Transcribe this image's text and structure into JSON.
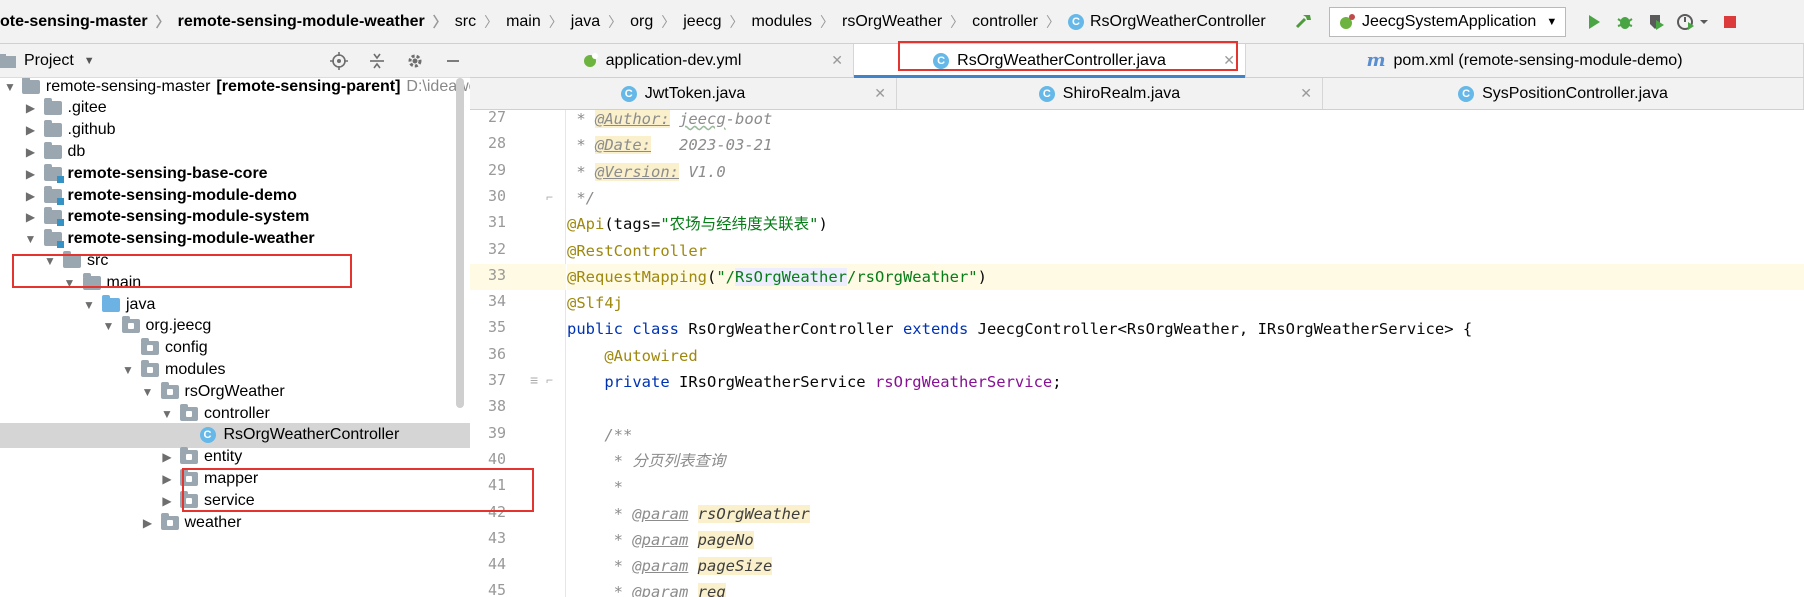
{
  "breadcrumbs": [
    {
      "label": "ote-sensing-master",
      "bold": true
    },
    {
      "label": "remote-sensing-module-weather",
      "bold": true
    },
    {
      "label": "src"
    },
    {
      "label": "main"
    },
    {
      "label": "java"
    },
    {
      "label": "org"
    },
    {
      "label": "jeecg"
    },
    {
      "label": "modules"
    },
    {
      "label": "rsOrgWeather"
    },
    {
      "label": "controller"
    },
    {
      "label": "RsOrgWeatherController",
      "icon": "class"
    }
  ],
  "toolbar": {
    "run_config": "JeecgSystemApplication"
  },
  "project_pane": {
    "title": "Project"
  },
  "tree": [
    {
      "label": "remote-sensing-master",
      "suffix": "[remote-sensing-parent]",
      "muted": "D:\\ideawo",
      "indent": 0,
      "arrow": "down",
      "icon": "folder",
      "bold": false
    },
    {
      "label": ".gitee",
      "indent": 1,
      "arrow": "right",
      "icon": "folder"
    },
    {
      "label": ".github",
      "indent": 1,
      "arrow": "right",
      "icon": "folder"
    },
    {
      "label": "db",
      "indent": 1,
      "arrow": "right",
      "icon": "folder"
    },
    {
      "label": "remote-sensing-base-core",
      "indent": 1,
      "arrow": "right",
      "icon": "module",
      "bold": true
    },
    {
      "label": "remote-sensing-module-demo",
      "indent": 1,
      "arrow": "right",
      "icon": "module",
      "bold": true
    },
    {
      "label": "remote-sensing-module-system",
      "indent": 1,
      "arrow": "right",
      "icon": "module",
      "bold": true
    },
    {
      "label": "remote-sensing-module-weather",
      "indent": 1,
      "arrow": "down",
      "icon": "module",
      "bold": true
    },
    {
      "label": "src",
      "indent": 2,
      "arrow": "down",
      "icon": "folder"
    },
    {
      "label": "main",
      "indent": 3,
      "arrow": "down",
      "icon": "folder"
    },
    {
      "label": "java",
      "indent": 4,
      "arrow": "down",
      "icon": "blue"
    },
    {
      "label": "org.jeecg",
      "indent": 5,
      "arrow": "down",
      "icon": "pkg"
    },
    {
      "label": "config",
      "indent": 6,
      "arrow": "none",
      "icon": "pkg"
    },
    {
      "label": "modules",
      "indent": 6,
      "arrow": "down",
      "icon": "pkg"
    },
    {
      "label": "rsOrgWeather",
      "indent": 7,
      "arrow": "down",
      "icon": "pkg"
    },
    {
      "label": "controller",
      "indent": 8,
      "arrow": "down",
      "icon": "pkg"
    },
    {
      "label": "RsOrgWeatherController",
      "indent": 9,
      "arrow": "none",
      "icon": "class",
      "selected": true
    },
    {
      "label": "entity",
      "indent": 8,
      "arrow": "right",
      "icon": "pkg"
    },
    {
      "label": "mapper",
      "indent": 8,
      "arrow": "right",
      "icon": "pkg"
    },
    {
      "label": "service",
      "indent": 8,
      "arrow": "right",
      "icon": "pkg"
    },
    {
      "label": "weather",
      "indent": 7,
      "arrow": "right",
      "icon": "pkg"
    }
  ],
  "tabs_row1": [
    {
      "label": "application-dev.yml",
      "icon": "yml",
      "closable": true
    },
    {
      "label": "RsOrgWeatherController.java",
      "icon": "class",
      "closable": true,
      "active": true
    },
    {
      "label": "pom.xml (remote-sensing-module-demo)",
      "icon": "maven",
      "closable": false
    }
  ],
  "tabs_row2": [
    {
      "label": "JwtToken.java",
      "icon": "class",
      "closable": true
    },
    {
      "label": "ShiroRealm.java",
      "icon": "class",
      "closable": true
    },
    {
      "label": "SysPositionController.java",
      "icon": "class",
      "closable": false
    }
  ],
  "code": {
    "line_numbers": [
      "27",
      "28",
      "29",
      "30",
      "31",
      "32",
      "33",
      "34",
      "35",
      "36",
      "37",
      "38",
      "39",
      "40",
      "41",
      "42",
      "43",
      "44",
      "45"
    ],
    "lines": [
      [
        {
          "t": " * ",
          "c": "c-comment"
        },
        {
          "t": "@Author:",
          "c": "c-tag"
        },
        {
          "t": " ",
          "c": "c-comment"
        },
        {
          "t": "jeecg",
          "c": "c-comment c-wavy"
        },
        {
          "t": "-boot",
          "c": "c-comment"
        }
      ],
      [
        {
          "t": " * ",
          "c": "c-comment"
        },
        {
          "t": "@Date:",
          "c": "c-tag"
        },
        {
          "t": "   2023-03-21",
          "c": "c-comment"
        }
      ],
      [
        {
          "t": " * ",
          "c": "c-comment"
        },
        {
          "t": "@Version:",
          "c": "c-tag"
        },
        {
          "t": " V1.0",
          "c": "c-comment"
        }
      ],
      [
        {
          "t": " */",
          "c": "c-comment"
        }
      ],
      [
        {
          "t": "@Api",
          "c": "c-ann"
        },
        {
          "t": "(tags=",
          "c": "c-plain"
        },
        {
          "t": "\"农场与经纬度关联表\"",
          "c": "c-str"
        },
        {
          "t": ")",
          "c": "c-plain"
        }
      ],
      [
        {
          "t": "@RestController",
          "c": "c-ann"
        }
      ],
      [
        {
          "t": "@RequestMapping",
          "c": "c-ann"
        },
        {
          "t": "(",
          "c": "c-plain"
        },
        {
          "t": "\"/",
          "c": "c-str"
        },
        {
          "t": "RsOrgWeather",
          "c": "c-str c-mark"
        },
        {
          "t": "/rsOrgWeather\"",
          "c": "c-str"
        },
        {
          "t": ")",
          "c": "c-plain"
        }
      ],
      [
        {
          "t": "@Slf4j",
          "c": "c-ann"
        }
      ],
      [
        {
          "t": "public class ",
          "c": "c-kw"
        },
        {
          "t": "RsOrgWeatherController ",
          "c": "c-plain"
        },
        {
          "t": "extends ",
          "c": "c-kw"
        },
        {
          "t": "JeecgController<RsOrgWeather, IRsOrgWeatherService> {",
          "c": "c-plain"
        }
      ],
      [
        {
          "t": "    ",
          "c": "c-plain"
        },
        {
          "t": "@Autowired",
          "c": "c-ann"
        }
      ],
      [
        {
          "t": "    ",
          "c": "c-plain"
        },
        {
          "t": "private ",
          "c": "c-kw"
        },
        {
          "t": "IRsOrgWeatherService ",
          "c": "c-plain"
        },
        {
          "t": "rsOrgWeatherService",
          "c": "c-field"
        },
        {
          "t": ";",
          "c": "c-plain"
        }
      ],
      [
        {
          "t": "",
          "c": "c-plain"
        }
      ],
      [
        {
          "t": "    /**",
          "c": "c-comment"
        }
      ],
      [
        {
          "t": "     * 分页列表查询",
          "c": "c-comment"
        }
      ],
      [
        {
          "t": "     *",
          "c": "c-comment"
        }
      ],
      [
        {
          "t": "     * ",
          "c": "c-comment"
        },
        {
          "t": "@param",
          "c": "c-tag-plain"
        },
        {
          "t": " ",
          "c": "c-comment"
        },
        {
          "t": "rsOrgWeather",
          "c": "c-param-name"
        }
      ],
      [
        {
          "t": "     * ",
          "c": "c-comment"
        },
        {
          "t": "@param",
          "c": "c-tag-plain"
        },
        {
          "t": " ",
          "c": "c-comment"
        },
        {
          "t": "pageNo",
          "c": "c-param-name"
        }
      ],
      [
        {
          "t": "     * ",
          "c": "c-comment"
        },
        {
          "t": "@param",
          "c": "c-tag-plain"
        },
        {
          "t": " ",
          "c": "c-comment"
        },
        {
          "t": "pageSize",
          "c": "c-param-name"
        }
      ],
      [
        {
          "t": "     * ",
          "c": "c-comment"
        },
        {
          "t": "@param",
          "c": "c-tag-plain"
        },
        {
          "t": " ",
          "c": "c-comment"
        },
        {
          "t": "req",
          "c": "c-param-name"
        }
      ]
    ],
    "highlighted_line": "33"
  },
  "colors": {
    "highlight_box": "#e3342f",
    "active_tab_underline": "#4083c9",
    "selected_row": "#d5d5d5"
  }
}
